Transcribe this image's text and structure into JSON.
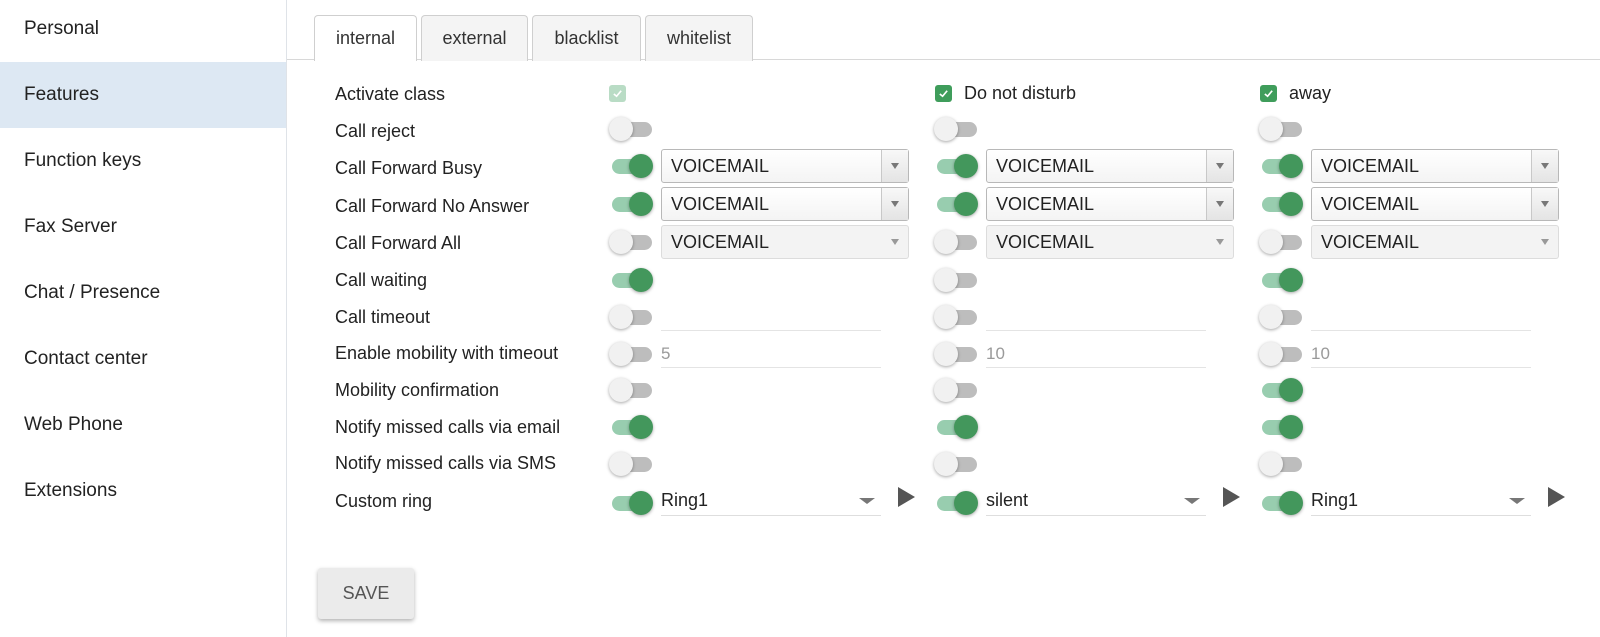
{
  "sidebar": {
    "items": [
      {
        "label": "Personal",
        "active": false
      },
      {
        "label": "Features",
        "active": true
      },
      {
        "label": "Function keys",
        "active": false
      },
      {
        "label": "Fax Server",
        "active": false
      },
      {
        "label": "Chat / Presence",
        "active": false
      },
      {
        "label": "Contact center",
        "active": false
      },
      {
        "label": "Web Phone",
        "active": false
      },
      {
        "label": "Extensions",
        "active": false
      }
    ]
  },
  "tabs": [
    {
      "label": "internal",
      "active": true
    },
    {
      "label": "external",
      "active": false
    },
    {
      "label": "blacklist",
      "active": false
    },
    {
      "label": "whitelist",
      "active": false
    }
  ],
  "colors": {
    "accent_green": "#43975c",
    "accent_green_light": "#98cdaf",
    "sidebar_active": "#dde8f3"
  },
  "columns": [
    {
      "checkbox_label": "",
      "checked": true,
      "checkbox_disabled": true
    },
    {
      "checkbox_label": "Do not disturb",
      "checked": true,
      "checkbox_disabled": false
    },
    {
      "checkbox_label": "away",
      "checked": true,
      "checkbox_disabled": false
    }
  ],
  "rows": {
    "activate_class": {
      "label": "Activate class"
    },
    "call_reject": {
      "label": "Call reject",
      "values": [
        false,
        false,
        false
      ]
    },
    "cf_busy": {
      "label": "Call Forward Busy",
      "values": [
        true,
        true,
        true
      ],
      "targets": [
        "VOICEMAIL",
        "VOICEMAIL",
        "VOICEMAIL"
      ]
    },
    "cf_no_answer": {
      "label": "Call Forward No Answer",
      "values": [
        true,
        true,
        true
      ],
      "targets": [
        "VOICEMAIL",
        "VOICEMAIL",
        "VOICEMAIL"
      ]
    },
    "cf_all": {
      "label": "Call Forward All",
      "values": [
        false,
        false,
        false
      ],
      "targets": [
        "VOICEMAIL",
        "VOICEMAIL",
        "VOICEMAIL"
      ]
    },
    "call_waiting": {
      "label": "Call waiting",
      "values": [
        true,
        false,
        true
      ]
    },
    "call_timeout": {
      "label": "Call timeout",
      "values": [
        false,
        false,
        false
      ],
      "inputs": [
        "",
        "",
        ""
      ]
    },
    "mobility_timeout": {
      "label": "Enable mobility with timeout",
      "values": [
        false,
        false,
        false
      ],
      "inputs": [
        "5",
        "10",
        "10"
      ]
    },
    "mobility_confirmation": {
      "label": "Mobility confirmation",
      "values": [
        false,
        false,
        true
      ]
    },
    "notify_email": {
      "label": "Notify missed calls via email",
      "values": [
        true,
        true,
        true
      ]
    },
    "notify_sms": {
      "label": "Notify missed calls via SMS",
      "values": [
        false,
        false,
        false
      ]
    },
    "custom_ring": {
      "label": "Custom ring",
      "values": [
        true,
        true,
        true
      ],
      "rings": [
        "Ring1",
        "silent",
        "Ring1"
      ]
    }
  },
  "save_label": "SAVE"
}
